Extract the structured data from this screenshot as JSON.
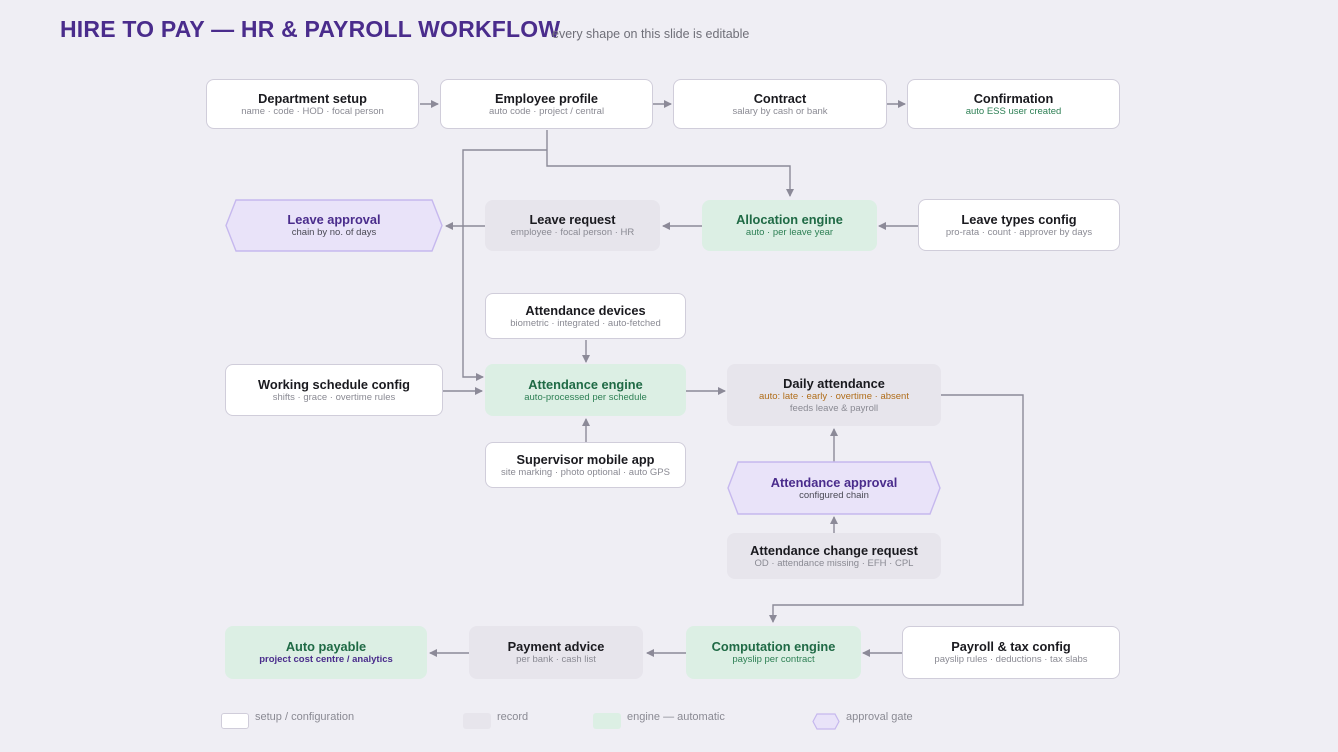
{
  "header": {
    "title": "HIRE TO PAY — HR & PAYROLL WORKFLOW",
    "subtitle": "every shape on this slide is editable"
  },
  "nodes": {
    "department_setup": {
      "title": "Department setup",
      "sub": "name · code · HOD · focal person"
    },
    "employee_profile": {
      "title": "Employee profile",
      "sub": "auto code · project / central"
    },
    "contract": {
      "title": "Contract",
      "sub": "salary by cash or bank"
    },
    "confirmation": {
      "title": "Confirmation",
      "sub": "auto ESS user created"
    },
    "leave_approval": {
      "title": "Leave approval",
      "sub": "chain by no. of days"
    },
    "leave_request": {
      "title": "Leave request",
      "sub": "employee · focal person · HR"
    },
    "allocation_engine": {
      "title": "Allocation engine",
      "sub": "auto · per leave year"
    },
    "leave_types_config": {
      "title": "Leave types config",
      "sub": "pro-rata · count · approver by days"
    },
    "attendance_devices": {
      "title": "Attendance devices",
      "sub": "biometric · integrated · auto-fetched"
    },
    "working_schedule_config": {
      "title": "Working schedule config",
      "sub": "shifts · grace · overtime rules"
    },
    "attendance_engine": {
      "title": "Attendance engine",
      "sub": "auto-processed per schedule"
    },
    "daily_attendance": {
      "title": "Daily attendance",
      "sub": "auto: late · early · overtime · absent",
      "sub2": "feeds leave & payroll"
    },
    "supervisor_mobile_app": {
      "title": "Supervisor mobile app",
      "sub": "site marking · photo optional · auto GPS"
    },
    "attendance_approval": {
      "title": "Attendance approval",
      "sub": "configured chain"
    },
    "attendance_change_request": {
      "title": "Attendance change request",
      "sub": "OD · attendance missing · EFH · CPL"
    },
    "auto_payable": {
      "title": "Auto payable",
      "sub": "project cost centre / analytics"
    },
    "payment_advice": {
      "title": "Payment advice",
      "sub": "per bank · cash list"
    },
    "computation_engine": {
      "title": "Computation engine",
      "sub": "payslip per contract"
    },
    "payroll_tax_config": {
      "title": "Payroll & tax config",
      "sub": "payslip rules · deductions · tax slabs"
    }
  },
  "legend": {
    "setup": "setup / configuration",
    "record": "record",
    "engine": "engine — automatic",
    "approval": "approval gate"
  },
  "colors": {
    "background": "#efeef4",
    "accent": "#4a2c8c",
    "engine_fill": "#dcefe4",
    "engine_text": "#1f6a45",
    "record_fill": "#e7e5ec",
    "approval_fill": "#e9e3f9",
    "approval_stroke": "#c6b8ee",
    "connector": "#8c8a98"
  }
}
